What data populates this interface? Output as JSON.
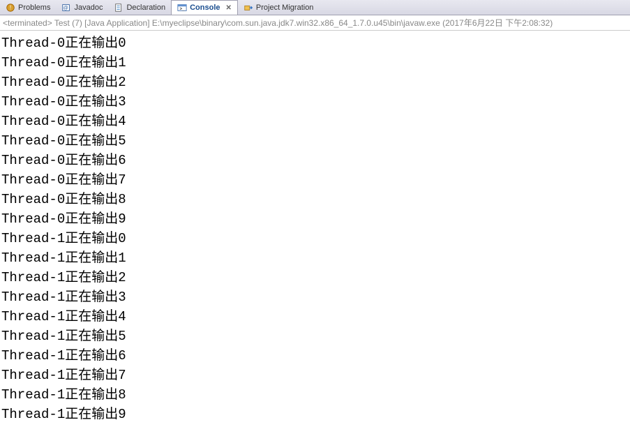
{
  "tabs": [
    {
      "label": "Problems",
      "active": false,
      "icon": "problems"
    },
    {
      "label": "Javadoc",
      "active": false,
      "icon": "javadoc"
    },
    {
      "label": "Declaration",
      "active": false,
      "icon": "declaration"
    },
    {
      "label": "Console",
      "active": true,
      "icon": "console",
      "closable": true
    },
    {
      "label": "Project Migration",
      "active": false,
      "icon": "migration"
    }
  ],
  "status": "<terminated> Test (7) [Java Application] E:\\myeclipse\\binary\\com.sun.java.jdk7.win32.x86_64_1.7.0.u45\\bin\\javaw.exe (2017年6月22日 下午2:08:32)",
  "output": [
    "Thread-0正在输出0",
    "Thread-0正在输出1",
    "Thread-0正在输出2",
    "Thread-0正在输出3",
    "Thread-0正在输出4",
    "Thread-0正在输出5",
    "Thread-0正在输出6",
    "Thread-0正在输出7",
    "Thread-0正在输出8",
    "Thread-0正在输出9",
    "Thread-1正在输出0",
    "Thread-1正在输出1",
    "Thread-1正在输出2",
    "Thread-1正在输出3",
    "Thread-1正在输出4",
    "Thread-1正在输出5",
    "Thread-1正在输出6",
    "Thread-1正在输出7",
    "Thread-1正在输出8",
    "Thread-1正在输出9"
  ]
}
